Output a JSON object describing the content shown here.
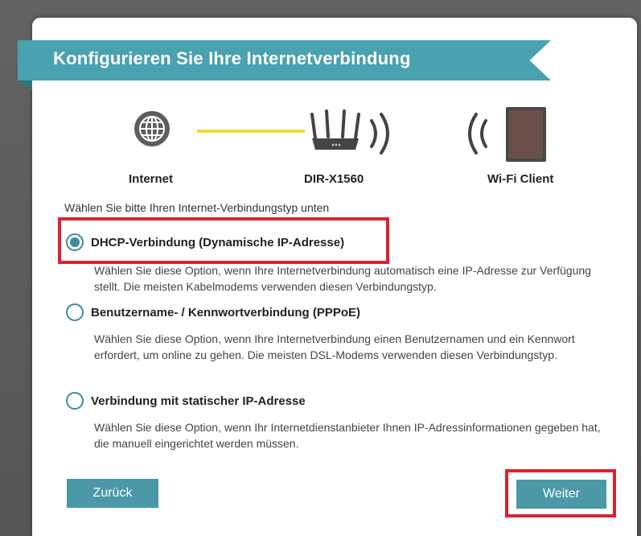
{
  "dialog": {
    "title": "Konfigurieren Sie Ihre Internetverbindung"
  },
  "diagram": {
    "internet_label": "Internet",
    "router_label": "DIR-X1560",
    "client_label": "Wi-Fi Client",
    "link_color": "#f2dc2c"
  },
  "intro_text": "Wählen Sie bitte Ihren Internet-Verbindungstyp unten",
  "options": [
    {
      "label": "DHCP-Verbindung (Dynamische IP-Adresse)",
      "description": "Wählen Sie diese Option, wenn Ihre Internetverbindung automatisch eine IP-Adresse zur Verfügung stellt. Die meisten Kabelmodems verwenden diesen Verbindungstyp.",
      "selected": true,
      "highlighted": true
    },
    {
      "label": "Benutzername- / Kennwortverbindung (PPPoE)",
      "description": "Wählen Sie diese Option, wenn Ihre Internetverbindung einen Benutzernamen und ein Kennwort erfordert, um online zu gehen. Die meisten DSL-Modems verwenden diesen Verbindungstyp.",
      "selected": false,
      "highlighted": false
    },
    {
      "label": "Verbindung mit statischer IP-Adresse",
      "description": "Wählen Sie diese Option, wenn Ihr Internetdienstanbieter Ihnen IP-Adressinformationen gegeben hat, die manuell eingerichtet werden müssen.",
      "selected": false,
      "highlighted": false
    }
  ],
  "buttons": {
    "back_label": "Zurück",
    "next_label": "Weiter"
  },
  "colors": {
    "accent": "#4aa1af",
    "highlight": "#d9232e"
  }
}
